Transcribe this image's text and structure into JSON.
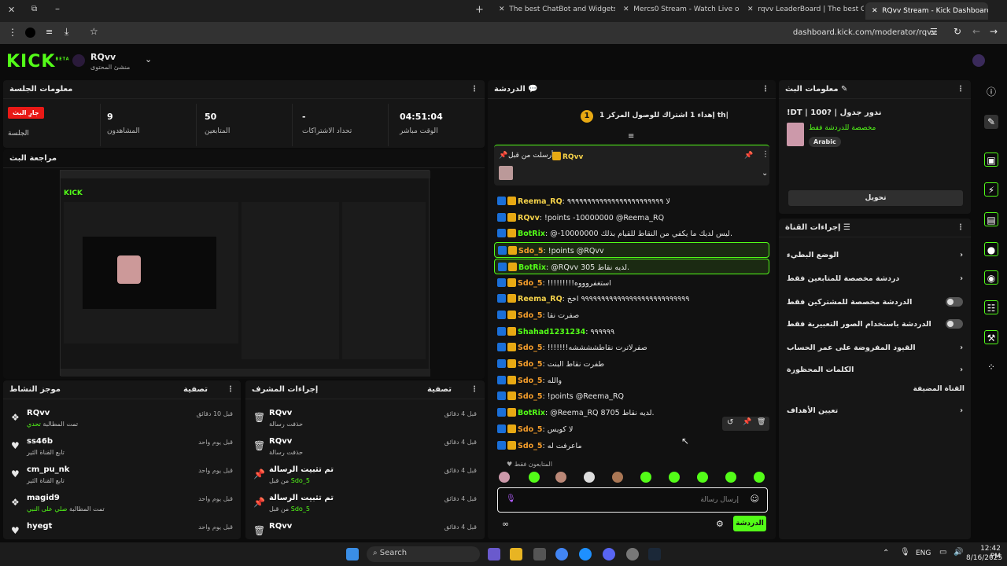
{
  "browser": {
    "tabs": [
      {
        "label": "The best ChatBot and Widgets"
      },
      {
        "label": "Mercs0 Stream - Watch Live on"
      },
      {
        "label": "rqvv LeaderBoard | The best Ch"
      },
      {
        "label": "RQvv Stream - Kick Dashboard"
      }
    ],
    "new_tab": "+",
    "url": "dashboard.kick.com/moderator/rqvv"
  },
  "app": {
    "logo": "KICK",
    "logo_beta": "BETA",
    "channel_name": "RQvv",
    "channel_role": "منشئ المحتوى"
  },
  "session": {
    "title": "معلومات الجلسة",
    "live_badge": "جارِ البث",
    "session_label": "الجلسة",
    "stats": [
      {
        "value": "9",
        "label": "المشاهدون"
      },
      {
        "value": "50",
        "label": "المتابعين"
      },
      {
        "value": "-",
        "label": "تحداد الاشتراكات"
      },
      {
        "value": "04:51:04",
        "label": "الوقت مباشر"
      }
    ]
  },
  "preview": {
    "title": "مراجعة البث"
  },
  "activity": {
    "title": "موجز النشاط",
    "filter": "تصفية",
    "items": [
      {
        "name": "RQvv",
        "sub": "تمت المطالبة",
        "sub_green": "تحدي",
        "time": "قبل 10 دقائق"
      },
      {
        "name": "ss46b",
        "sub": "تابع القناة الثير",
        "time": "قبل يوم واحد"
      },
      {
        "name": "cm_pu_nk",
        "sub": "تابع القناة الثير",
        "time": "قبل يوم واحد"
      },
      {
        "name": "magid9",
        "sub": "تمت المطالبة",
        "sub_green": "صلي على النبي",
        "time": "قبل يوم واحد"
      },
      {
        "name": "hyegt",
        "sub": "",
        "time": "قبل يوم واحد"
      }
    ]
  },
  "mod_actions": {
    "title": "إجراءات المشرف",
    "filter": "تصفية",
    "items": [
      {
        "name": "RQvv",
        "sub": "حذفت رسالة",
        "time": "قبل 4 دقائق"
      },
      {
        "name": "RQvv",
        "sub": "حذفت رسالة",
        "time": "قبل 4 دقائق"
      },
      {
        "name": "تم تثبيت الرسالة",
        "sub": "من قبل",
        "sub_green": "Sdo_5",
        "time": "قبل 4 دقائق"
      },
      {
        "name": "تم تثبيت الرسالة",
        "sub": "من قبل",
        "sub_green": "Sdo_5",
        "time": "قبل 4 دقائق"
      },
      {
        "name": "RQvv",
        "sub": "",
        "time": "قبل 4 دقائق"
      }
    ]
  },
  "chat": {
    "title": "الدردشة",
    "goal_number": "1",
    "goal_text": "إهداء 1 اشتراك للوصول المركز 1 th|",
    "pinned_by": "أرسلت من قبل",
    "pinned_user": "RQvv",
    "messages": [
      {
        "user": "Reema_RQ",
        "cls": "nm-y",
        "text": "لا ٩٩٩٩٩٩٩٩٩٩٩٩٩٩٩٩٩٩٩٩٩٩٩٩",
        "hl": false
      },
      {
        "user": "RQvv",
        "cls": "nm-y",
        "text": "!points -10000000 @Reema_RQ",
        "hl": false
      },
      {
        "user": "BotRix",
        "cls": "nm-g",
        "text": "@-10000000 ليس لديك ما يكفي من النقاط للقيام بذلك.",
        "hl": false
      },
      {
        "user": "Sdo_5",
        "cls": "nm-o",
        "text": "!points @RQvv",
        "hl": true
      },
      {
        "user": "BotRix",
        "cls": "nm-g",
        "text": "@RQvv 305 لديه نقاط.",
        "hl": true
      },
      {
        "user": "Sdo_5",
        "cls": "nm-o",
        "text": "!!!!!!!!!استغفروووه",
        "hl": false
      },
      {
        "user": "Reema_RQ",
        "cls": "nm-y",
        "text": "٩٩٩٩٩٩٩٩٩٩٩٩٩٩٩٩٩٩٩٩٩٩٩٩٩٩٩ اخخ",
        "hl": false
      },
      {
        "user": "Sdo_5",
        "cls": "nm-o",
        "text": "صفرت نقا",
        "hl": false
      },
      {
        "user": "Shahad1231234",
        "cls": "nm-g",
        "text": "٩٩٩٩٩٩",
        "hl": false
      },
      {
        "user": "Sdo_5",
        "cls": "nm-o",
        "text": "!!!!!!!صفرلاترت نقاطششششه",
        "hl": false
      },
      {
        "user": "Sdo_5",
        "cls": "nm-o",
        "text": "طفرت نقاط البنت",
        "hl": false
      },
      {
        "user": "Sdo_5",
        "cls": "nm-o",
        "text": "والله",
        "hl": false
      },
      {
        "user": "Sdo_5",
        "cls": "nm-o",
        "text": "!points @Reema_RQ",
        "hl": false
      },
      {
        "user": "BotRix",
        "cls": "nm-g",
        "text": "@Reema_RQ 8705 لديه نقاط.",
        "hl": false
      },
      {
        "user": "Sdo_5",
        "cls": "nm-o",
        "text": "لا كويس",
        "hl": false
      },
      {
        "user": "Sdo_5",
        "cls": "nm-o",
        "text": "ماعرفت له",
        "hl": false
      }
    ],
    "followers_only": "المتابعون فقط",
    "input_placeholder": "إرسال رسالة",
    "send_label": "الدردشة"
  },
  "stream_info": {
    "title": "معلومات البث",
    "stream_title": "!DT | 100? | ندور جدول",
    "category": "مخصصة للدردشة فقط",
    "language": "Arabic",
    "edit_button": "تحويل"
  },
  "channel_actions": {
    "title": "إجراءات القناة",
    "items": [
      {
        "label": "الوضع البطيء",
        "control": "chevron"
      },
      {
        "label": "دردشة مخصصة للمتابعين فقط",
        "control": "chevron"
      },
      {
        "label": "الدردشة مخصصة للمشتركين فقط",
        "control": "toggle"
      },
      {
        "label": "الدردشة باستخدام الصور التعبيرية فقط",
        "control": "toggle"
      },
      {
        "label": "القيود المفروضة على عمر الحساب",
        "control": "chevron"
      },
      {
        "label": "الكلمات المحظورة",
        "control": "chevron"
      }
    ],
    "section_label": "القناة المضيفة",
    "goals_item": "تعيين الأهداف"
  },
  "taskbar": {
    "search": "Search",
    "lang": "ENG",
    "time": "12:42 PM",
    "date": "8/16/2025"
  },
  "colors": {
    "accent": "#53fc18",
    "live": "#e91916",
    "panel": "#161616"
  }
}
